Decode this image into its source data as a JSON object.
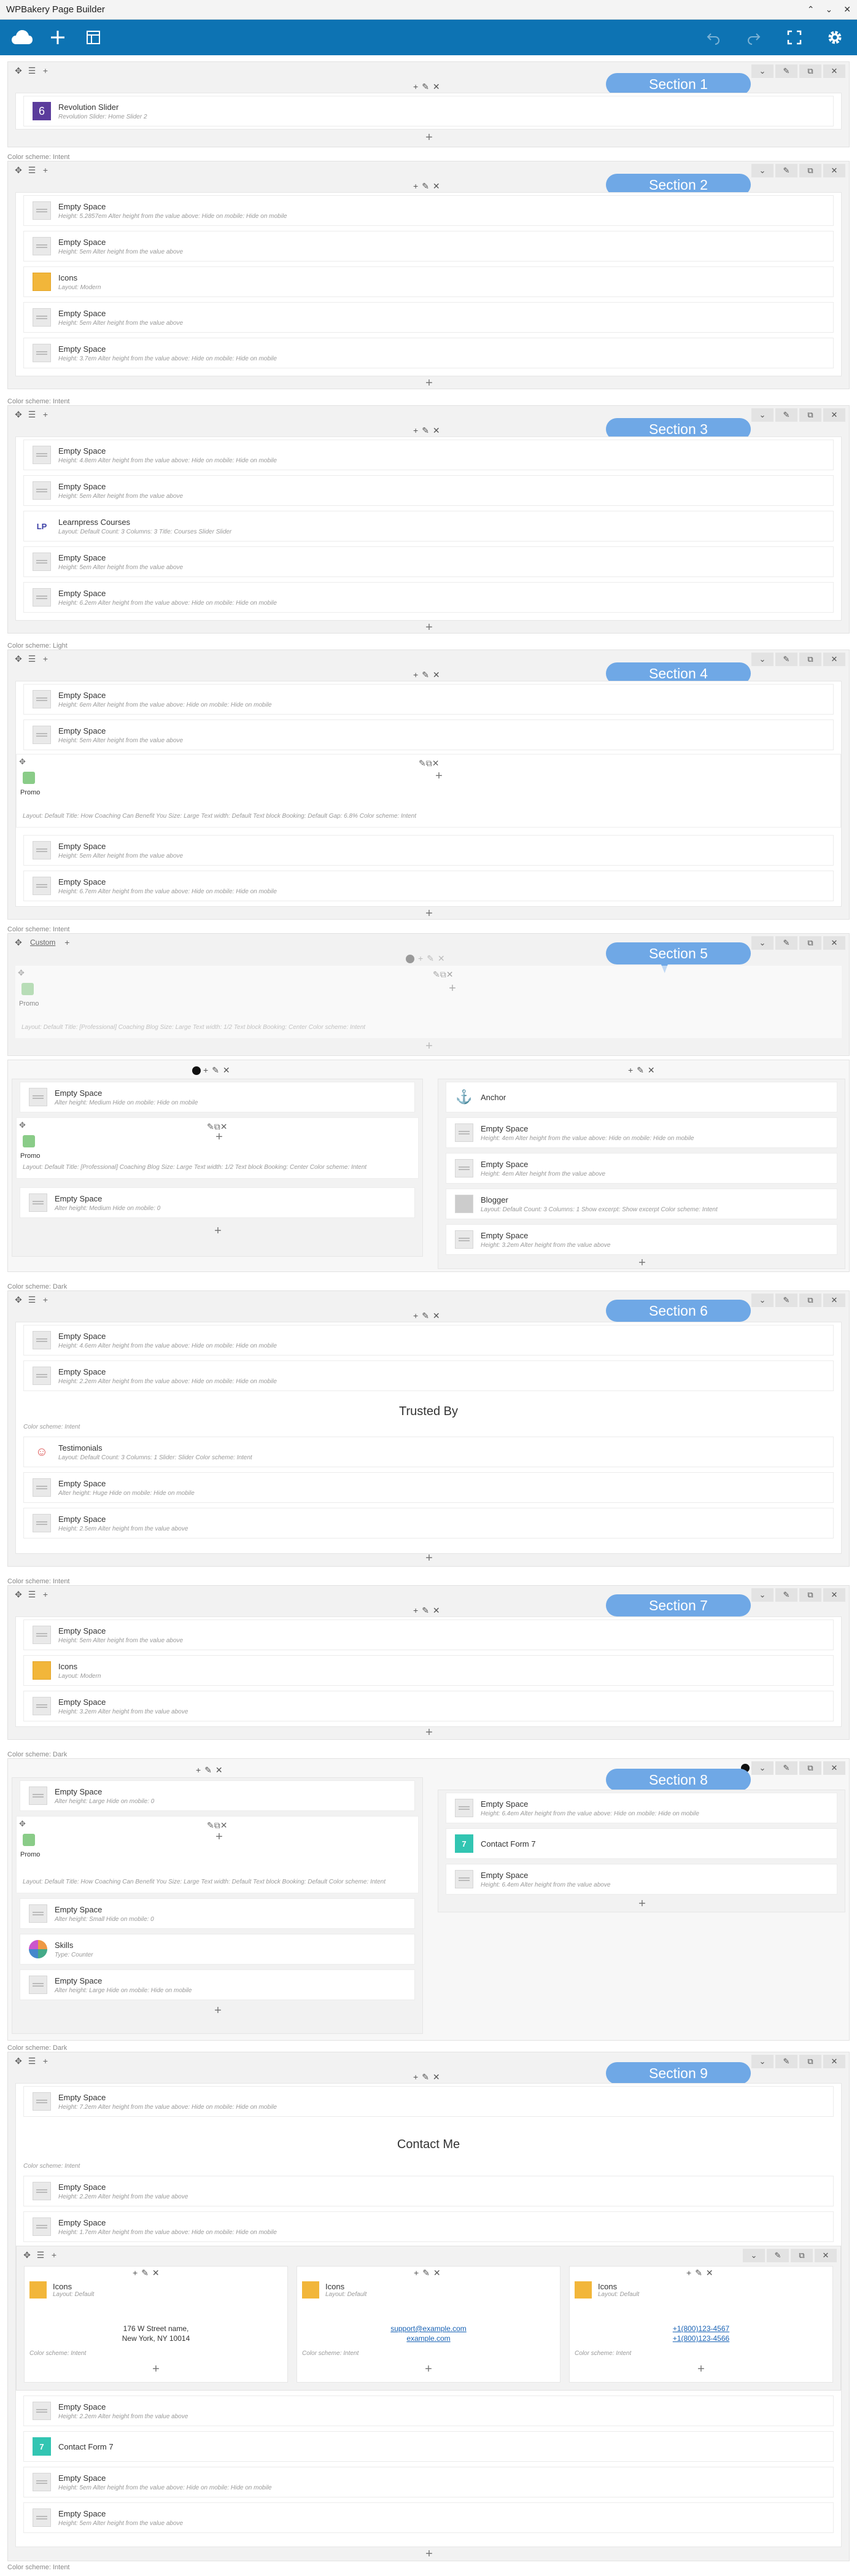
{
  "app": {
    "title": "WPBakery Page Builder"
  },
  "window": {
    "minimize": "⌃",
    "restore": "⌄",
    "close": "✕"
  },
  "schemes": {
    "intent": "Color scheme: Intent",
    "light": "Color scheme: Light",
    "dark": "Color scheme: Dark"
  },
  "sections": [
    "Section 1",
    "Section 2",
    "Section 3",
    "Section 4",
    "Section 5",
    "Section 6",
    "Section 7",
    "Section 8",
    "Section 9"
  ],
  "s1": {
    "name": "Revolution Slider",
    "sub": "Revolution Slider: Home Slider 2"
  },
  "s2": {
    "e1": {
      "name": "Empty Space",
      "sub": "Height: 5.2857em  Alter height from the value above: Hide on mobile: Hide on mobile"
    },
    "e2": {
      "name": "Empty Space",
      "sub": "Height: 5em  Alter height from the value above"
    },
    "e3": {
      "name": "Icons",
      "sub": "Layout: Modern"
    },
    "e4": {
      "name": "Empty Space",
      "sub": "Height: 5em  Alter height from the value above"
    },
    "e5": {
      "name": "Empty Space",
      "sub": "Height: 3.7em  Alter height from the value above: Hide on mobile: Hide on mobile"
    }
  },
  "s3": {
    "e1": {
      "name": "Empty Space",
      "sub": "Height: 4.8em  Alter height from the value above: Hide on mobile: Hide on mobile"
    },
    "e2": {
      "name": "Empty Space",
      "sub": "Height: 5em  Alter height from the value above"
    },
    "e3": {
      "name": "Learnpress Courses",
      "sub": "Layout: Default  Count: 3  Columns: 3  Title: Courses  Slider Slider"
    },
    "e4": {
      "name": "Empty Space",
      "sub": "Height: 5em  Alter height from the value above"
    },
    "e5": {
      "name": "Empty Space",
      "sub": "Height: 6.2em  Alter height from the value above: Hide on mobile: Hide on mobile"
    }
  },
  "s4": {
    "e1": {
      "name": "Empty Space",
      "sub": "Height: 6em  Alter height from the value above: Hide on mobile: Hide on mobile"
    },
    "e2": {
      "name": "Empty Space",
      "sub": "Height: 5em  Alter height from the value above"
    },
    "promo": "Promo",
    "promo_desc": "Layout: Default  Title: How Coaching Can Benefit You  Size: Large  Text width: Default  Text block Booking: Default  Gap: 6.8%  Color scheme: Intent",
    "e3": {
      "name": "Empty Space",
      "sub": "Height: 5em  Alter height from the value above"
    },
    "e4": {
      "name": "Empty Space",
      "sub": "Height: 6.7em  Alter height from the value above: Hide on mobile: Hide on mobile"
    }
  },
  "s5": {
    "custom": "Custom",
    "promo": "Promo",
    "promo_desc": "Layout: Default  Title: [Professional] Coaching Blog  Size: Large  Text width: 1/2  Text block Booking: Center  Color scheme: Intent"
  },
  "s5b": {
    "l1": {
      "name": "Empty Space",
      "sub": "Alter height: Medium  Hide on mobile: Hide on mobile"
    },
    "promo": "Promo",
    "promo_desc": "Layout: Default  Title: [Professional] Coaching Blog  Size: Large  Text width: 1/2  Text block Booking: Center  Color scheme: Intent",
    "l2": {
      "name": "Empty Space",
      "sub": "Alter height: Medium  Hide on mobile: 0"
    },
    "r1": {
      "name": "Anchor",
      "sub": ""
    },
    "r2": {
      "name": "Empty Space",
      "sub": "Height: 4em  Alter height from the value above: Hide on mobile: Hide on mobile"
    },
    "r3": {
      "name": "Empty Space",
      "sub": "Height: 4em  Alter height from the value above"
    },
    "r4": {
      "name": "Blogger",
      "sub": "Layout: Default  Count: 3  Columns: 1  Show excerpt: Show excerpt  Color scheme: Intent"
    },
    "r5": {
      "name": "Empty Space",
      "sub": "Height: 3.2em  Alter height from the value above"
    }
  },
  "s6": {
    "e1": {
      "name": "Empty Space",
      "sub": "Height: 4.6em  Alter height from the value above: Hide on mobile: Hide on mobile"
    },
    "e2": {
      "name": "Empty Space",
      "sub": "Height: 2.2em  Alter height from the value above: Hide on mobile: Hide on mobile"
    },
    "trusted": "Trusted By",
    "scheme": "Color scheme: Intent",
    "e3": {
      "name": "Testimonials",
      "sub": "Layout: Default  Count: 3  Columns: 1  Slider: Slider  Color scheme: Intent"
    },
    "e4": {
      "name": "Empty Space",
      "sub": "Alter height: Huge  Hide on mobile: Hide on mobile"
    },
    "e5": {
      "name": "Empty Space",
      "sub": "Height: 2.5em  Alter height from the value above"
    }
  },
  "s7": {
    "e1": {
      "name": "Empty Space",
      "sub": "Height: 5em  Alter height from the value above"
    },
    "e2": {
      "name": "Icons",
      "sub": "Layout: Modern"
    },
    "e3": {
      "name": "Empty Space",
      "sub": "Height: 3.2em  Alter height from the value above"
    }
  },
  "s8": {
    "l1": {
      "name": "Empty Space",
      "sub": "Alter height: Large  Hide on mobile: 0"
    },
    "promo": "Promo",
    "promo_desc": "Layout: Default  Title: How Coaching Can Benefit You  Size: Large  Text width: Default  Text block Booking: Default  Color scheme: Intent",
    "l2": {
      "name": "Empty Space",
      "sub": "Alter height: Small  Hide on mobile: 0"
    },
    "l3": {
      "name": "Skills",
      "sub": "Type: Counter"
    },
    "l4": {
      "name": "Empty Space",
      "sub": "Alter height: Large  Hide on mobile: Hide on mobile"
    },
    "r1": {
      "name": "Empty Space",
      "sub": "Height: 6.4em  Alter height from the value above: Hide on mobile: Hide on mobile"
    },
    "r2": {
      "name": "Contact Form 7",
      "sub": ""
    },
    "r3": {
      "name": "Empty Space",
      "sub": "Height: 6.4em  Alter height from the value above"
    }
  },
  "s9": {
    "e1": {
      "name": "Empty Space",
      "sub": "Height: 7.2em  Alter height from the value above: Hide on mobile: Hide on mobile"
    },
    "contact": "Contact Me",
    "scheme": "Color scheme: Intent",
    "e2": {
      "name": "Empty Space",
      "sub": "Height: 2.2em  Alter height from the value above"
    },
    "e3": {
      "name": "Empty Space",
      "sub": "Height: 1.7em  Alter height from the value above: Hide on mobile: Hide on mobile"
    },
    "c1": {
      "name": "Icons",
      "sub": "Layout: Default",
      "line1": "176 W Street name,",
      "line2": "New York, NY 10014",
      "scheme": "Color scheme: Intent"
    },
    "c2": {
      "name": "Icons",
      "sub": "Layout: Default",
      "line1": "support@example.com",
      "line2": "example.com",
      "scheme": "Color scheme: Intent"
    },
    "c3": {
      "name": "Icons",
      "sub": "Layout: Default",
      "line1": "+1(800)123-4567",
      "line2": "+1(800)123-4566",
      "scheme": "Color scheme: Intent"
    },
    "e4": {
      "name": "Empty Space",
      "sub": "Height: 2.2em  Alter height from the value above"
    },
    "e5": {
      "name": "Contact Form 7",
      "sub": ""
    },
    "e6": {
      "name": "Empty Space",
      "sub": "Height: 5em  Alter height from the value above: Hide on mobile: Hide on mobile"
    },
    "e7": {
      "name": "Empty Space",
      "sub": "Height: 5em  Alter height from the value above"
    }
  },
  "footer_scheme": "Color scheme: Intent"
}
